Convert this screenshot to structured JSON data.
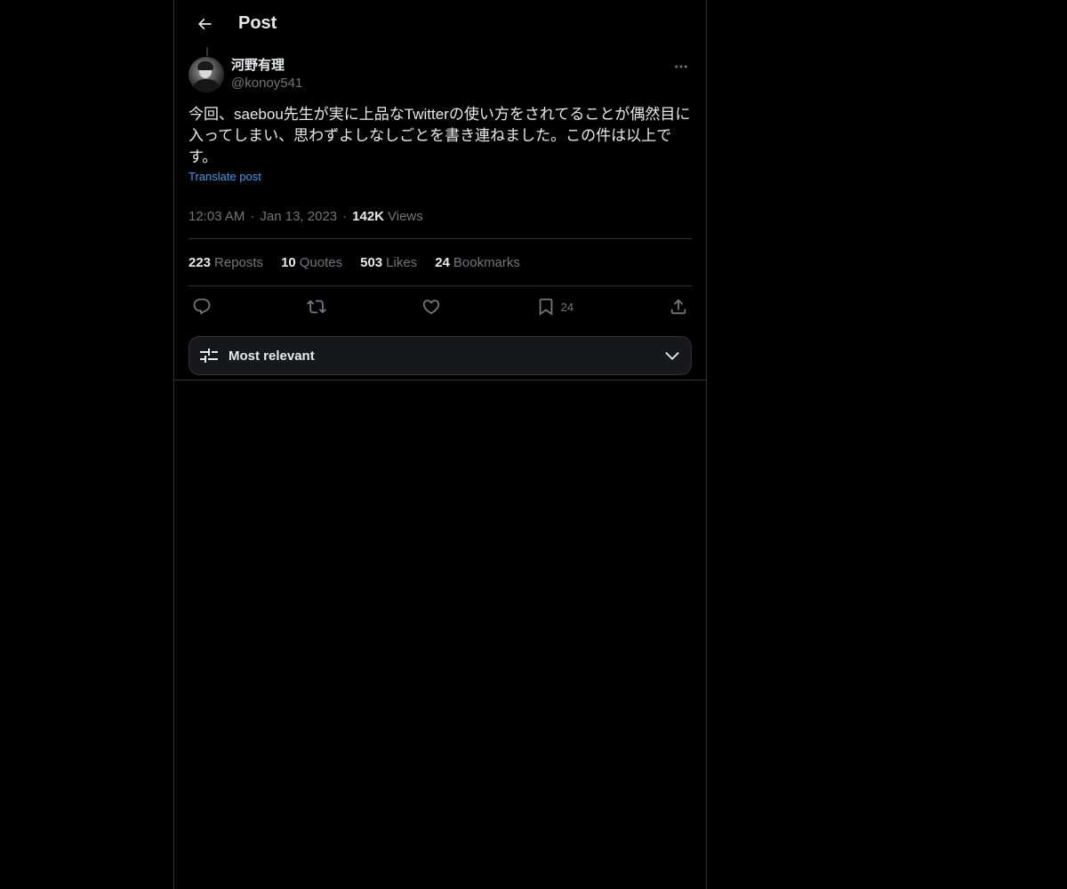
{
  "header": {
    "title": "Post"
  },
  "post": {
    "author": {
      "display_name": "河野有理",
      "handle": "@konoy541"
    },
    "text": "今回、saebou先生が実に上品なTwitterの使い方をされてることが偶然目に入ってしまい、思わずよしなしごとを書き連ねました。この件は以上です。",
    "translate_label": "Translate post",
    "time": "12:03 AM",
    "date": "Jan 13, 2023",
    "views_count": "142K",
    "views_label": "Views"
  },
  "stats": {
    "reposts": {
      "count": "223",
      "label": "Reposts"
    },
    "quotes": {
      "count": "10",
      "label": "Quotes"
    },
    "likes": {
      "count": "503",
      "label": "Likes"
    },
    "bookmarks": {
      "count": "24",
      "label": "Bookmarks"
    }
  },
  "actions": {
    "bookmark_count": "24"
  },
  "sort": {
    "label": "Most relevant"
  },
  "icons": {
    "back": "arrow-left-icon",
    "more": "more-horizontal-icon",
    "reply": "reply-icon",
    "repost": "repost-icon",
    "like": "heart-icon",
    "bookmark": "bookmark-icon",
    "share": "share-icon",
    "sort": "sliders-icon",
    "chevron": "chevron-down-icon"
  },
  "colors": {
    "background": "#000000",
    "text_primary": "#e7e9ea",
    "text_secondary": "#71767b",
    "link": "#4a99e9",
    "border": "#2f3336"
  }
}
